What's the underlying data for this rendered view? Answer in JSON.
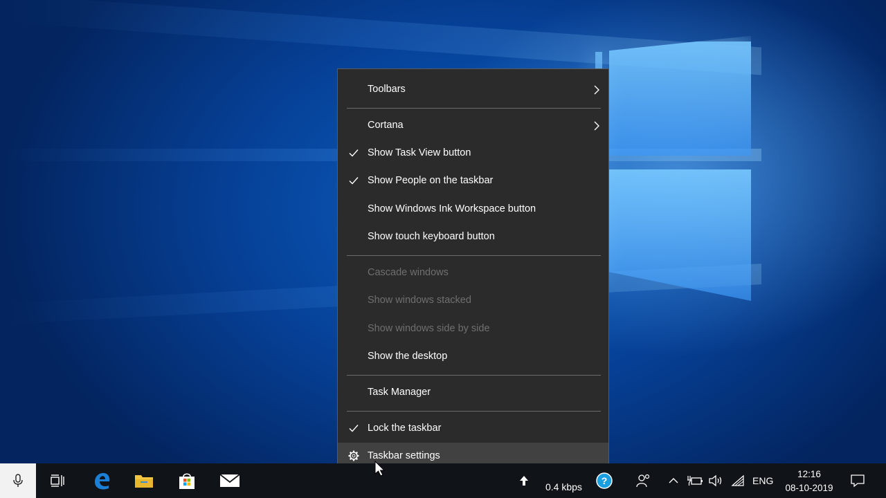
{
  "context_menu": {
    "items": [
      {
        "label": "Toolbars",
        "checked": false,
        "submenu": true,
        "enabled": true
      },
      {
        "label": "Cortana",
        "checked": false,
        "submenu": true,
        "enabled": true
      },
      {
        "label": "Show Task View button",
        "checked": true,
        "submenu": false,
        "enabled": true
      },
      {
        "label": "Show People on the taskbar",
        "checked": true,
        "submenu": false,
        "enabled": true
      },
      {
        "label": "Show Windows Ink Workspace button",
        "checked": false,
        "submenu": false,
        "enabled": true
      },
      {
        "label": "Show touch keyboard button",
        "checked": false,
        "submenu": false,
        "enabled": true
      },
      {
        "label": "Cascade windows",
        "checked": false,
        "submenu": false,
        "enabled": false
      },
      {
        "label": "Show windows stacked",
        "checked": false,
        "submenu": false,
        "enabled": false
      },
      {
        "label": "Show windows side by side",
        "checked": false,
        "submenu": false,
        "enabled": false
      },
      {
        "label": "Show the desktop",
        "checked": false,
        "submenu": false,
        "enabled": true
      },
      {
        "label": "Task Manager",
        "checked": false,
        "submenu": false,
        "enabled": true
      },
      {
        "label": "Lock the taskbar",
        "checked": true,
        "submenu": false,
        "enabled": true
      },
      {
        "label": "Taskbar settings",
        "checked": false,
        "submenu": false,
        "enabled": true,
        "icon": "gear-icon",
        "hovered": true
      }
    ]
  },
  "taskbar": {
    "pinned": [
      {
        "name": "microphone-icon"
      },
      {
        "name": "task-view-icon"
      },
      {
        "name": "edge-icon"
      },
      {
        "name": "file-explorer-icon"
      },
      {
        "name": "store-icon"
      },
      {
        "name": "mail-icon"
      }
    ],
    "network_speed": "0.4 kbps",
    "language": "ENG",
    "time": "12:16",
    "date": "08-10-2019"
  },
  "colors": {
    "menu_bg": "#2b2b2b",
    "menu_hover": "#414141",
    "taskbar_bg": "#101317",
    "edge_blue": "#1c7fd6",
    "explorer_yellow": "#f2c443"
  }
}
